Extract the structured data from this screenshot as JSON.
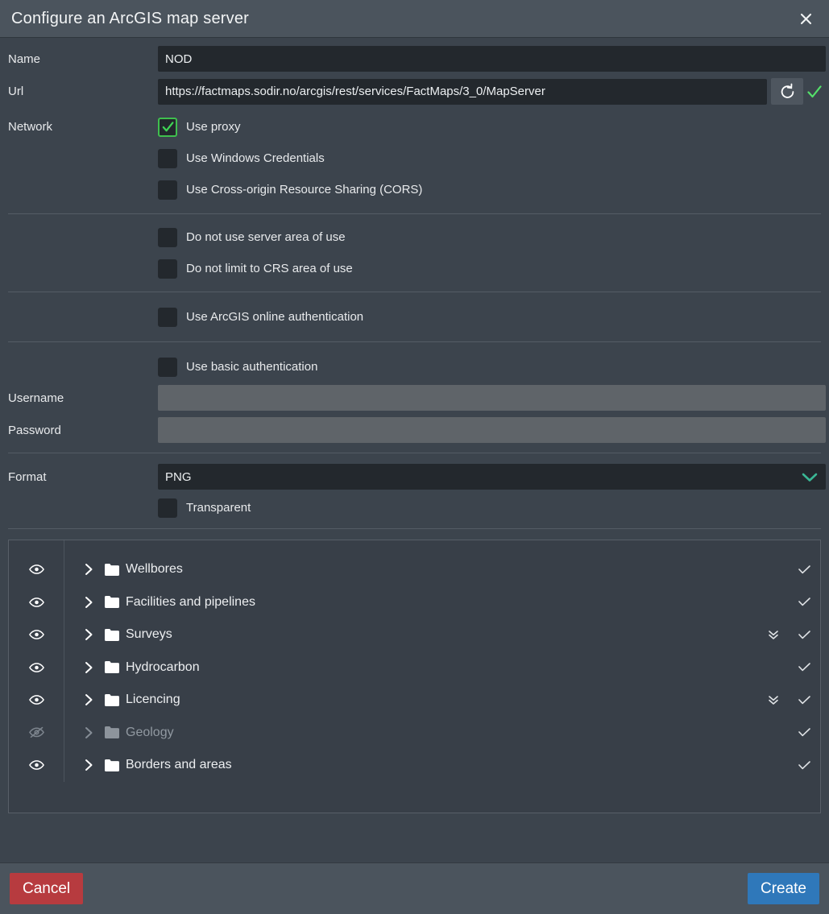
{
  "window": {
    "title": "Configure an ArcGIS map server",
    "close_icon": "close-icon"
  },
  "form": {
    "name": {
      "label": "Name",
      "value": "NOD",
      "placeholder": ""
    },
    "url": {
      "label": "Url",
      "value": "https://factmaps.sodir.no/arcgis/rest/services/FactMaps/3_0/MapServer",
      "placeholder": "",
      "refresh_icon": "refresh-icon",
      "valid_icon": "checkmark-icon"
    },
    "network": {
      "label": "Network",
      "options": [
        {
          "label": "Use proxy",
          "checked": true
        },
        {
          "label": "Use Windows Credentials",
          "checked": false
        },
        {
          "label": "Use Cross-origin Resource Sharing (CORS)",
          "checked": false
        }
      ]
    },
    "area_of_use": {
      "options": [
        {
          "label": "Do not use server area of use",
          "checked": false
        },
        {
          "label": "Do not limit to CRS area of use",
          "checked": false
        }
      ]
    },
    "arcgis_auth": {
      "options": [
        {
          "label": "Use ArcGIS online authentication",
          "checked": false
        }
      ]
    },
    "basic_auth": {
      "options": [
        {
          "label": "Use basic authentication",
          "checked": false
        }
      ],
      "username": {
        "label": "Username",
        "value": "",
        "placeholder": "",
        "disabled": true
      },
      "password": {
        "label": "Password",
        "value": "",
        "placeholder": "",
        "disabled": true
      }
    },
    "format": {
      "label": "Format",
      "value": "PNG",
      "options": [
        "PNG"
      ],
      "chevron_icon": "chevron-down-icon",
      "transparent": {
        "label": "Transparent",
        "checked": false
      }
    }
  },
  "layers": {
    "rows": [
      {
        "name": "Wellbores",
        "visible": true,
        "expanded": false,
        "has_legend_toggle": false,
        "checked": true
      },
      {
        "name": "Facilities and pipelines",
        "visible": true,
        "expanded": false,
        "has_legend_toggle": false,
        "checked": true
      },
      {
        "name": "Surveys",
        "visible": true,
        "expanded": false,
        "has_legend_toggle": true,
        "checked": true
      },
      {
        "name": "Hydrocarbon",
        "visible": true,
        "expanded": false,
        "has_legend_toggle": false,
        "checked": true
      },
      {
        "name": "Licencing",
        "visible": true,
        "expanded": false,
        "has_legend_toggle": true,
        "checked": true
      },
      {
        "name": "Geology",
        "visible": false,
        "expanded": false,
        "has_legend_toggle": false,
        "checked": true
      },
      {
        "name": "Borders and areas",
        "visible": true,
        "expanded": false,
        "has_legend_toggle": false,
        "checked": true
      }
    ]
  },
  "footer": {
    "cancel_label": "Cancel",
    "create_label": "Create"
  },
  "colors": {
    "window_bg": "#3c444d",
    "titlebar_bg": "#4b545d",
    "input_bg": "#23282d",
    "input_disabled_bg": "#5f6469",
    "accent_green": "#3fbf4e",
    "accent_teal": "#3ab795",
    "cancel_red": "#b73b3f",
    "create_blue": "#2f78ba",
    "text": "#e8eaec",
    "text_dim": "#9199a1"
  }
}
